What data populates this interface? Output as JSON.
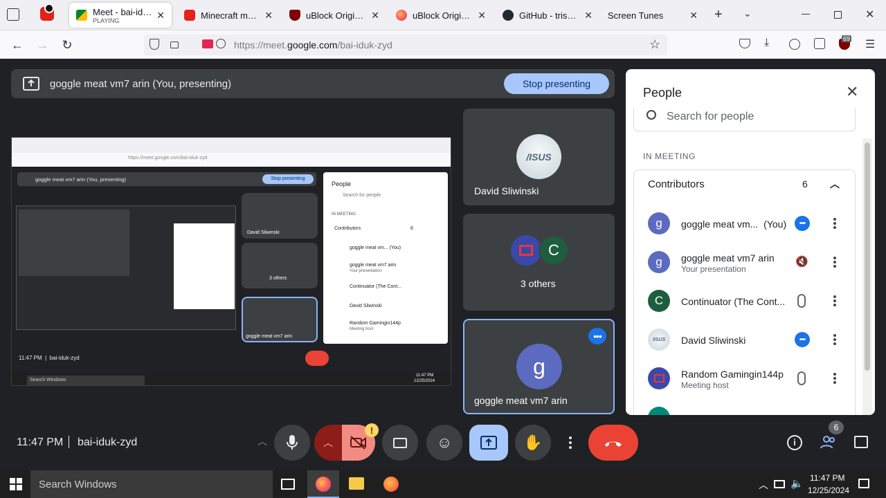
{
  "browser": {
    "tabs": [
      {
        "title": "Meet - bai-iduk-z",
        "subtitle": "PLAYING",
        "active": true
      },
      {
        "title": "Minecraft music d"
      },
      {
        "title": "uBlock Origin - Fr"
      },
      {
        "title": "uBlock Origin – G"
      },
      {
        "title": "GitHub - trishum"
      },
      {
        "title": "Screen Tunes"
      }
    ],
    "url_prefix": "https://meet.",
    "url_domain": "google.com",
    "url_path": "/bai-iduk-zyd",
    "extension_badge": "69"
  },
  "meet": {
    "presenting_text": "goggle meat vm7 arin (You, presenting)",
    "stop_presenting": "Stop presenting",
    "tiles": [
      {
        "name": "David Sliwinski"
      },
      {
        "name": "3 others",
        "avatar_letter": "C"
      },
      {
        "name": "goggle meat vm7 arin",
        "avatar_letter": "g"
      }
    ],
    "time": "11:47 PM",
    "meeting_code": "bai-iduk-zyd",
    "people_count_badge": "6",
    "camera_warning": "!",
    "captured_screen": {
      "presenting_text": "goggle meat vm7 arin (You, presenting)",
      "stop_presenting": "Stop presenting",
      "url": "https://meet.google.com/bai-iduk-zyd",
      "tile_names": [
        "David Sliwinski",
        "3 others",
        "goggle meat vm7 arin"
      ],
      "time_code": "11:47 PM  |  bai-iduk-zyd",
      "panel_title": "People",
      "panel_search": "Search for people",
      "in_meeting": "IN MEETING",
      "contributors": "Contributors",
      "contributors_count": "6",
      "rows": [
        {
          "name": "goggle meat vm... (You)"
        },
        {
          "name": "goggle meat vm7 arin",
          "sub": "Your presentation"
        },
        {
          "name": "Continuator (The Cont..."
        },
        {
          "name": "David Sliwinski"
        },
        {
          "name": "Random Gamingin144p",
          "sub": "Meeting host"
        }
      ],
      "taskbar_search": "Search Windows",
      "clock_time": "11:47 PM",
      "clock_date": "12/25/2024"
    }
  },
  "people_panel": {
    "title": "People",
    "search_placeholder": "Search for people",
    "section": "IN MEETING",
    "group": "Contributors",
    "group_count": "6",
    "rows": [
      {
        "name": "goggle meat vm...",
        "you": "(You)",
        "letter": "g",
        "color": "#5c6bc0"
      },
      {
        "name": "goggle meat vm7 arin",
        "sub": "Your presentation",
        "letter": "g",
        "color": "#5c6bc0"
      },
      {
        "name": "Continuator (The Cont...",
        "letter": "C",
        "color": "#1e5e3f"
      },
      {
        "name": "David Sliwinski",
        "letter": "",
        "color": "#e8eef2"
      },
      {
        "name": "Random Gamingin144p",
        "sub": "Meeting host",
        "letter": "",
        "color": "#3949ab"
      }
    ]
  },
  "taskbar": {
    "search": "Search Windows",
    "clock_time": "11:47 PM",
    "clock_date": "12/25/2024"
  },
  "colors": {
    "accent_blue": "#1a73e8",
    "stop_btn": "#a8c7fa",
    "hangup_red": "#ea4335",
    "meet_bg": "#202124"
  }
}
